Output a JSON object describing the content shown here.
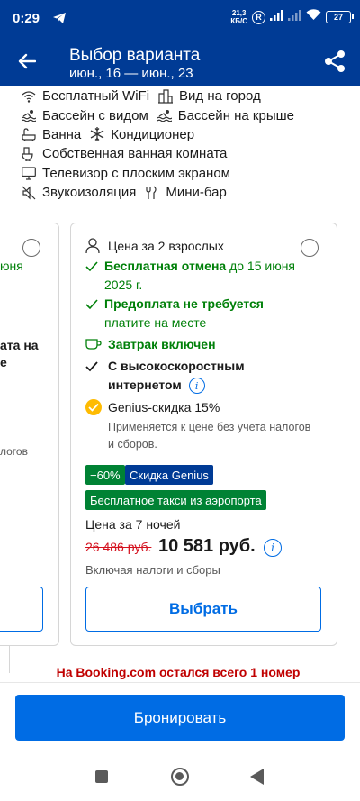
{
  "status_bar": {
    "time": "0:29",
    "speed_value": "21,3",
    "speed_unit": "КБ/С",
    "roaming": "R",
    "battery": "27"
  },
  "header": {
    "title": "Выбор варианта",
    "dates": "июн., 16 — июн., 23"
  },
  "amenities": [
    [
      {
        "icon": "wifi-icon",
        "label": "Бесплатный WiFi"
      },
      {
        "icon": "city-view-icon",
        "label": "Вид на город"
      }
    ],
    [
      {
        "icon": "pool-icon",
        "label": "Бассейн с видом"
      },
      {
        "icon": "rooftop-pool-icon",
        "label": "Бассейн на крыше"
      }
    ],
    [
      {
        "icon": "bath-icon",
        "label": "Ванна"
      },
      {
        "icon": "snowflake-icon",
        "label": "Кондиционер"
      }
    ],
    [
      {
        "icon": "bathroom-icon",
        "label": "Собственная ванная комната"
      }
    ],
    [
      {
        "icon": "tv-icon",
        "label": "Телевизор с плоским экраном"
      }
    ],
    [
      {
        "icon": "soundproof-icon",
        "label": "Звукоизоляция"
      },
      {
        "icon": "minibar-icon",
        "label": "Мини-бар"
      }
    ]
  ],
  "left_card": {
    "green_fragment": "юня",
    "bold_line1": "ата на",
    "bold_line2": "е",
    "gray_fragment": "логов"
  },
  "option": {
    "guests": "Цена за 2 взрослых",
    "free_cancel_bold": "Бесплатная отмена",
    "free_cancel_rest": " до 15 июня",
    "free_cancel_line2": "2025 г.",
    "no_prepay_bold": "Предоплата не требуется",
    "no_prepay_rest": " —",
    "no_prepay_line2": "платите на месте",
    "breakfast": "Завтрак включен",
    "internet_line1": "С высокоскоростным",
    "internet_line2": "интернетом",
    "genius_title": "Genius-скидка 15%",
    "genius_note1": "Применяется к цене без учета налогов",
    "genius_note2": "и сборов.",
    "badge_discount": "−60%",
    "badge_genius": "Скидка Genius",
    "badge_taxi": "Бесплатное такси из аэропорта",
    "nights_label": "Цена за 7 ночей",
    "old_price": "26 486 руб.",
    "new_price": "10 581 руб.",
    "taxes_note": "Включая налоги и сборы",
    "select_label": "Выбрать"
  },
  "urgency": "На Booking.com остался всего 1 номер",
  "book_label": "Бронировать",
  "colors": {
    "brand_dark": "#003b95",
    "brand_blue": "#006ce4",
    "green": "#008009",
    "badge_green": "#008234",
    "red": "#d4111e",
    "genius_yellow": "#febb02"
  }
}
